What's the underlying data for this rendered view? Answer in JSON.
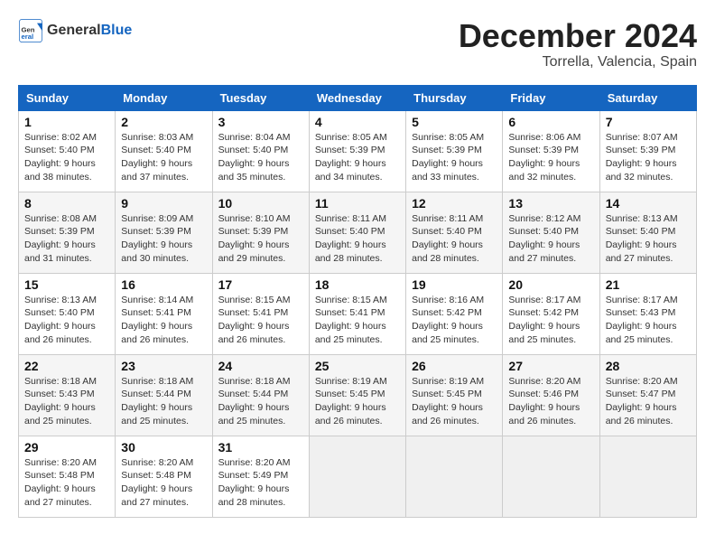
{
  "header": {
    "logo_general": "General",
    "logo_blue": "Blue",
    "month_title": "December 2024",
    "location": "Torrella, Valencia, Spain"
  },
  "columns": [
    "Sunday",
    "Monday",
    "Tuesday",
    "Wednesday",
    "Thursday",
    "Friday",
    "Saturday"
  ],
  "weeks": [
    [
      {
        "day": "1",
        "info": "Sunrise: 8:02 AM\nSunset: 5:40 PM\nDaylight: 9 hours and 38 minutes."
      },
      {
        "day": "2",
        "info": "Sunrise: 8:03 AM\nSunset: 5:40 PM\nDaylight: 9 hours and 37 minutes."
      },
      {
        "day": "3",
        "info": "Sunrise: 8:04 AM\nSunset: 5:40 PM\nDaylight: 9 hours and 35 minutes."
      },
      {
        "day": "4",
        "info": "Sunrise: 8:05 AM\nSunset: 5:39 PM\nDaylight: 9 hours and 34 minutes."
      },
      {
        "day": "5",
        "info": "Sunrise: 8:05 AM\nSunset: 5:39 PM\nDaylight: 9 hours and 33 minutes."
      },
      {
        "day": "6",
        "info": "Sunrise: 8:06 AM\nSunset: 5:39 PM\nDaylight: 9 hours and 32 minutes."
      },
      {
        "day": "7",
        "info": "Sunrise: 8:07 AM\nSunset: 5:39 PM\nDaylight: 9 hours and 32 minutes."
      }
    ],
    [
      {
        "day": "8",
        "info": "Sunrise: 8:08 AM\nSunset: 5:39 PM\nDaylight: 9 hours and 31 minutes."
      },
      {
        "day": "9",
        "info": "Sunrise: 8:09 AM\nSunset: 5:39 PM\nDaylight: 9 hours and 30 minutes."
      },
      {
        "day": "10",
        "info": "Sunrise: 8:10 AM\nSunset: 5:39 PM\nDaylight: 9 hours and 29 minutes."
      },
      {
        "day": "11",
        "info": "Sunrise: 8:11 AM\nSunset: 5:40 PM\nDaylight: 9 hours and 28 minutes."
      },
      {
        "day": "12",
        "info": "Sunrise: 8:11 AM\nSunset: 5:40 PM\nDaylight: 9 hours and 28 minutes."
      },
      {
        "day": "13",
        "info": "Sunrise: 8:12 AM\nSunset: 5:40 PM\nDaylight: 9 hours and 27 minutes."
      },
      {
        "day": "14",
        "info": "Sunrise: 8:13 AM\nSunset: 5:40 PM\nDaylight: 9 hours and 27 minutes."
      }
    ],
    [
      {
        "day": "15",
        "info": "Sunrise: 8:13 AM\nSunset: 5:40 PM\nDaylight: 9 hours and 26 minutes."
      },
      {
        "day": "16",
        "info": "Sunrise: 8:14 AM\nSunset: 5:41 PM\nDaylight: 9 hours and 26 minutes."
      },
      {
        "day": "17",
        "info": "Sunrise: 8:15 AM\nSunset: 5:41 PM\nDaylight: 9 hours and 26 minutes."
      },
      {
        "day": "18",
        "info": "Sunrise: 8:15 AM\nSunset: 5:41 PM\nDaylight: 9 hours and 25 minutes."
      },
      {
        "day": "19",
        "info": "Sunrise: 8:16 AM\nSunset: 5:42 PM\nDaylight: 9 hours and 25 minutes."
      },
      {
        "day": "20",
        "info": "Sunrise: 8:17 AM\nSunset: 5:42 PM\nDaylight: 9 hours and 25 minutes."
      },
      {
        "day": "21",
        "info": "Sunrise: 8:17 AM\nSunset: 5:43 PM\nDaylight: 9 hours and 25 minutes."
      }
    ],
    [
      {
        "day": "22",
        "info": "Sunrise: 8:18 AM\nSunset: 5:43 PM\nDaylight: 9 hours and 25 minutes."
      },
      {
        "day": "23",
        "info": "Sunrise: 8:18 AM\nSunset: 5:44 PM\nDaylight: 9 hours and 25 minutes."
      },
      {
        "day": "24",
        "info": "Sunrise: 8:18 AM\nSunset: 5:44 PM\nDaylight: 9 hours and 25 minutes."
      },
      {
        "day": "25",
        "info": "Sunrise: 8:19 AM\nSunset: 5:45 PM\nDaylight: 9 hours and 26 minutes."
      },
      {
        "day": "26",
        "info": "Sunrise: 8:19 AM\nSunset: 5:45 PM\nDaylight: 9 hours and 26 minutes."
      },
      {
        "day": "27",
        "info": "Sunrise: 8:20 AM\nSunset: 5:46 PM\nDaylight: 9 hours and 26 minutes."
      },
      {
        "day": "28",
        "info": "Sunrise: 8:20 AM\nSunset: 5:47 PM\nDaylight: 9 hours and 26 minutes."
      }
    ],
    [
      {
        "day": "29",
        "info": "Sunrise: 8:20 AM\nSunset: 5:48 PM\nDaylight: 9 hours and 27 minutes."
      },
      {
        "day": "30",
        "info": "Sunrise: 8:20 AM\nSunset: 5:48 PM\nDaylight: 9 hours and 27 minutes."
      },
      {
        "day": "31",
        "info": "Sunrise: 8:20 AM\nSunset: 5:49 PM\nDaylight: 9 hours and 28 minutes."
      },
      {
        "day": "",
        "info": ""
      },
      {
        "day": "",
        "info": ""
      },
      {
        "day": "",
        "info": ""
      },
      {
        "day": "",
        "info": ""
      }
    ]
  ]
}
